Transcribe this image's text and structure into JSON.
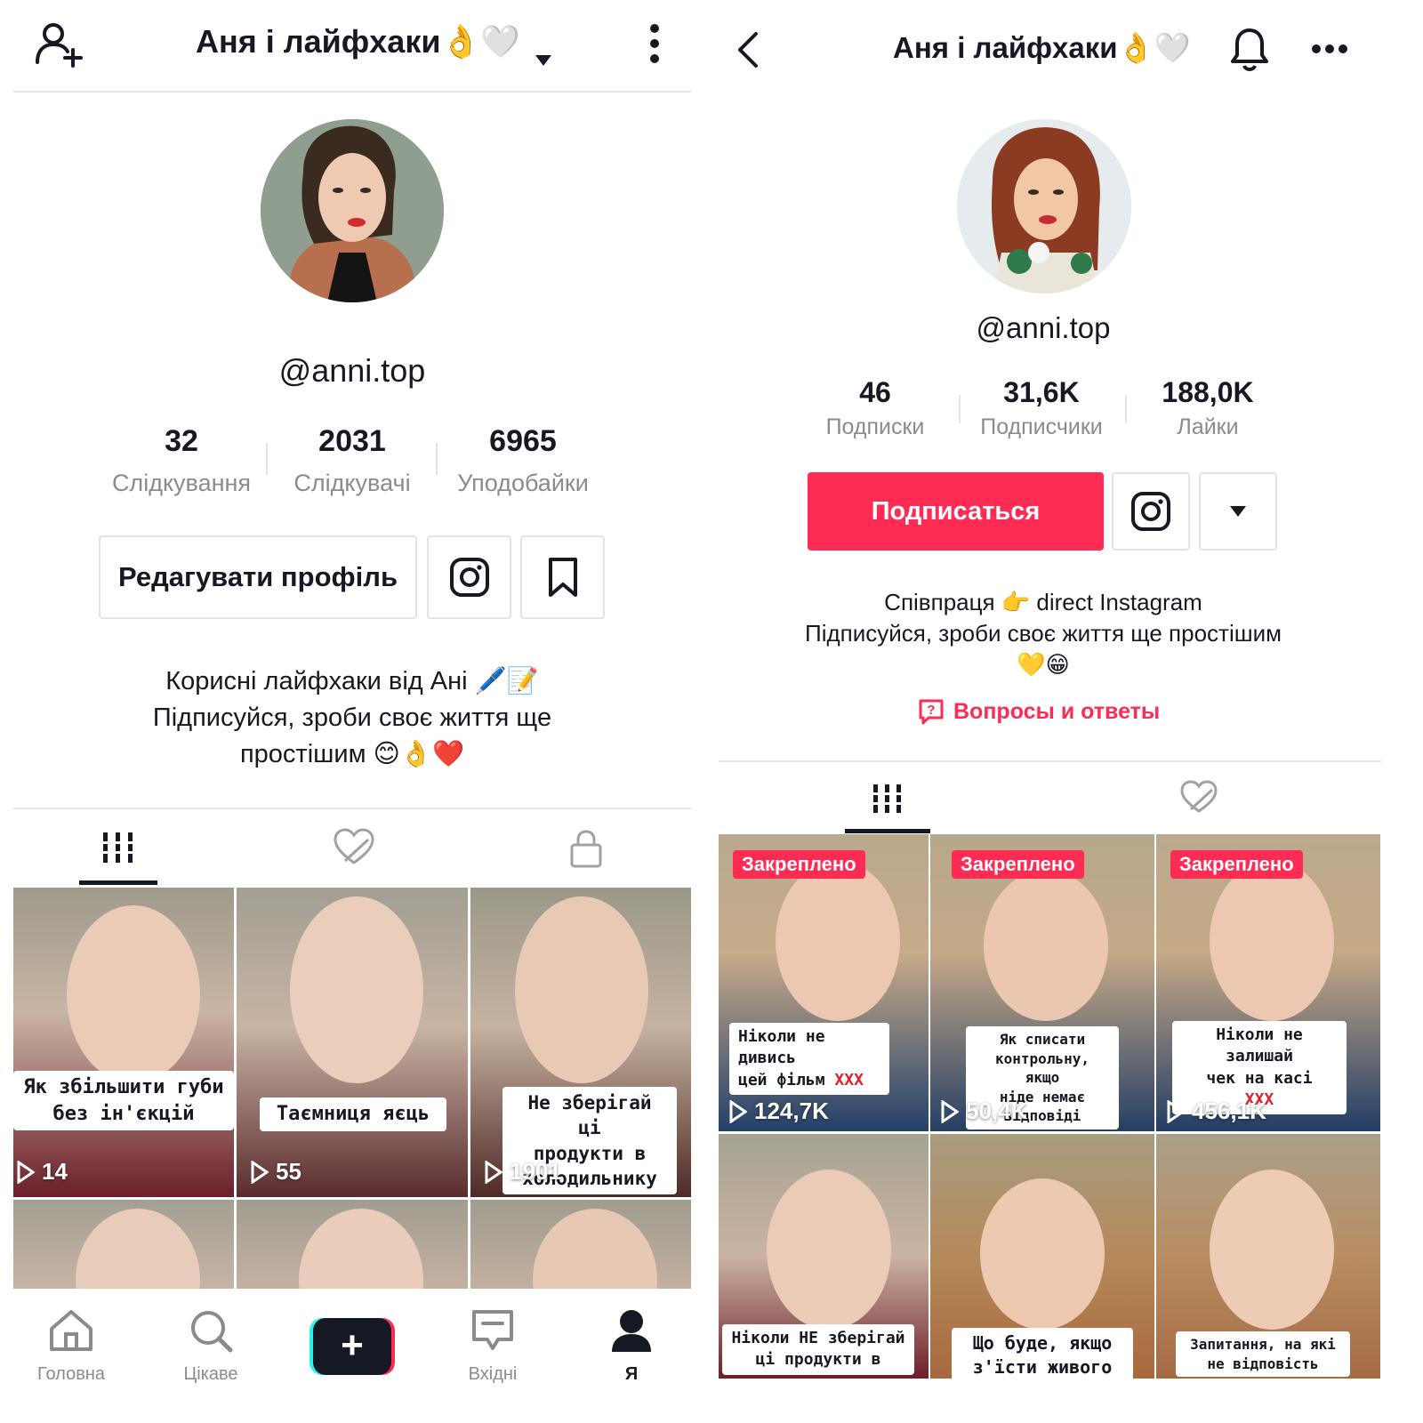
{
  "left": {
    "header": {
      "title": "Аня і лайфхаки",
      "title_emoji": "👌🤍"
    },
    "handle": "@anni.top",
    "stats": [
      {
        "value": "32",
        "label": "Слідкування"
      },
      {
        "value": "2031",
        "label": "Слідкувачі"
      },
      {
        "value": "6965",
        "label": "Уподобайки"
      }
    ],
    "edit_profile_label": "Редагувати профіль",
    "bio": {
      "line1": "Корисні лайфхаки від Ані 🖊️📝",
      "line2": "Підписуйся, зроби своє життя ще",
      "line3": "простішим 😊👌❤️"
    },
    "videos": [
      {
        "caption_lines": [
          "Як збільшити губи",
          "без ін'єкцій"
        ],
        "views": "14"
      },
      {
        "caption_lines": [
          "Таємниця яєць"
        ],
        "views": "55"
      },
      {
        "caption_lines": [
          "Не зберігай ці",
          "продукти в",
          "холодильнику"
        ],
        "views": "1901"
      }
    ],
    "nav": {
      "home": "Головна",
      "discover": "Цікаве",
      "create": "+",
      "inbox": "Вхідні",
      "me": "Я"
    }
  },
  "right": {
    "header": {
      "title": "Аня і лайфхаки",
      "title_emoji": "👌🤍"
    },
    "handle": "@anni.top",
    "stats": [
      {
        "value": "46",
        "label": "Подписки"
      },
      {
        "value": "31,6K",
        "label": "Подписчики"
      },
      {
        "value": "188,0K",
        "label": "Лайки"
      }
    ],
    "follow_label": "Подписаться",
    "bio": {
      "line1": "Співпраця 👉 direct Instagram",
      "line2": "Підписуйся, зроби своє життя ще простішим",
      "line3": "💛😁"
    },
    "qa_label": "Вопросы и ответы",
    "pinned_label": "Закреплено",
    "videos": [
      {
        "caption_lines": [
          "Ніколи не дивись",
          "цей фільм"
        ],
        "flag": "XXX",
        "views": "124,7K"
      },
      {
        "caption_lines": [
          "Як списати",
          "контрольну, якщо",
          "ніде немає",
          "відповіді"
        ],
        "flag": "",
        "views": "50,4K"
      },
      {
        "caption_lines": [
          "Ніколи не залишай",
          "чек на касі"
        ],
        "flag": "XXX",
        "views": "456,1K"
      },
      {
        "caption_lines": [
          "Ніколи НЕ зберігай",
          "ці продукти в"
        ],
        "flag": "",
        "views": ""
      },
      {
        "caption_lines": [
          "Що буде, якщо",
          "з'їсти живого"
        ],
        "flag": "",
        "views": ""
      },
      {
        "caption_lines": [
          "Запитання, на які",
          "не відповість"
        ],
        "flag": "",
        "views": ""
      }
    ]
  },
  "colors": {
    "accent": "#fe2c55",
    "text": "#161823",
    "muted": "#8a8b91",
    "border": "#e3e3e4"
  },
  "icons": {
    "add_user": "add-user-icon",
    "chevron_down": "chevron-down-icon",
    "more_vertical": "more-vertical-icon",
    "back": "back-arrow-icon",
    "bell": "bell-icon",
    "more_horizontal": "more-horizontal-icon",
    "instagram": "instagram-icon",
    "bookmark": "bookmark-icon",
    "grid": "grid-icon",
    "liked": "liked-hidden-icon",
    "lock": "lock-icon",
    "play": "play-icon",
    "question": "question-icon",
    "home": "home-icon",
    "search": "search-icon",
    "inbox": "inbox-icon",
    "profile": "profile-icon"
  }
}
